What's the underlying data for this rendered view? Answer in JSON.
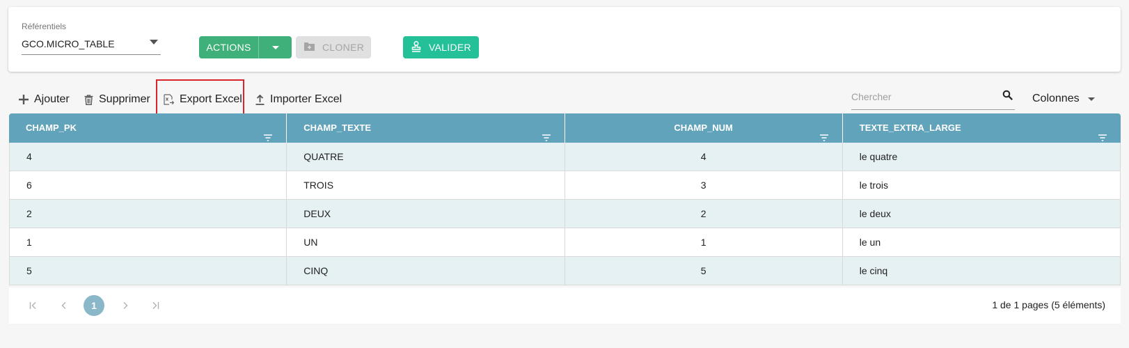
{
  "header": {
    "referentiels_label": "Référentiels",
    "referentiels_value": "GCO.MICRO_TABLE",
    "actions_label": "ACTIONS",
    "cloner_label": "CLONER",
    "valider_label": "VALIDER"
  },
  "toolbar": {
    "ajouter_label": "Ajouter",
    "supprimer_label": "Supprimer",
    "export_label": "Export Excel",
    "importer_label": "Importer Excel",
    "search_placeholder": "Chercher",
    "colonnes_label": "Colonnes"
  },
  "table": {
    "columns": [
      "CHAMP_PK",
      "CHAMP_TEXTE",
      "CHAMP_NUM",
      "TEXTE_EXTRA_LARGE"
    ],
    "rows": [
      [
        "4",
        "QUATRE",
        "4",
        "le quatre"
      ],
      [
        "6",
        "TROIS",
        "3",
        "le trois"
      ],
      [
        "2",
        "DEUX",
        "2",
        "le deux"
      ],
      [
        "1",
        "UN",
        "1",
        "le un"
      ],
      [
        "5",
        "CINQ",
        "5",
        "le cinq"
      ]
    ]
  },
  "pagination": {
    "current_page": "1",
    "info": "1 de 1 pages (5 éléments)"
  },
  "colors": {
    "actions_green": "#3fb07a",
    "valider_teal": "#24c199",
    "header_blue": "#62a3bc",
    "row_tint": "#e6f1f4",
    "highlight_red": "#d9252a"
  },
  "icons": [
    "plus-icon",
    "trash-icon",
    "excel-export-icon",
    "upload-icon",
    "search-icon",
    "filter-icon",
    "folder-plus-icon",
    "stamp-icon",
    "caret-down-icon",
    "first-page-icon",
    "prev-page-icon",
    "next-page-icon",
    "last-page-icon"
  ]
}
